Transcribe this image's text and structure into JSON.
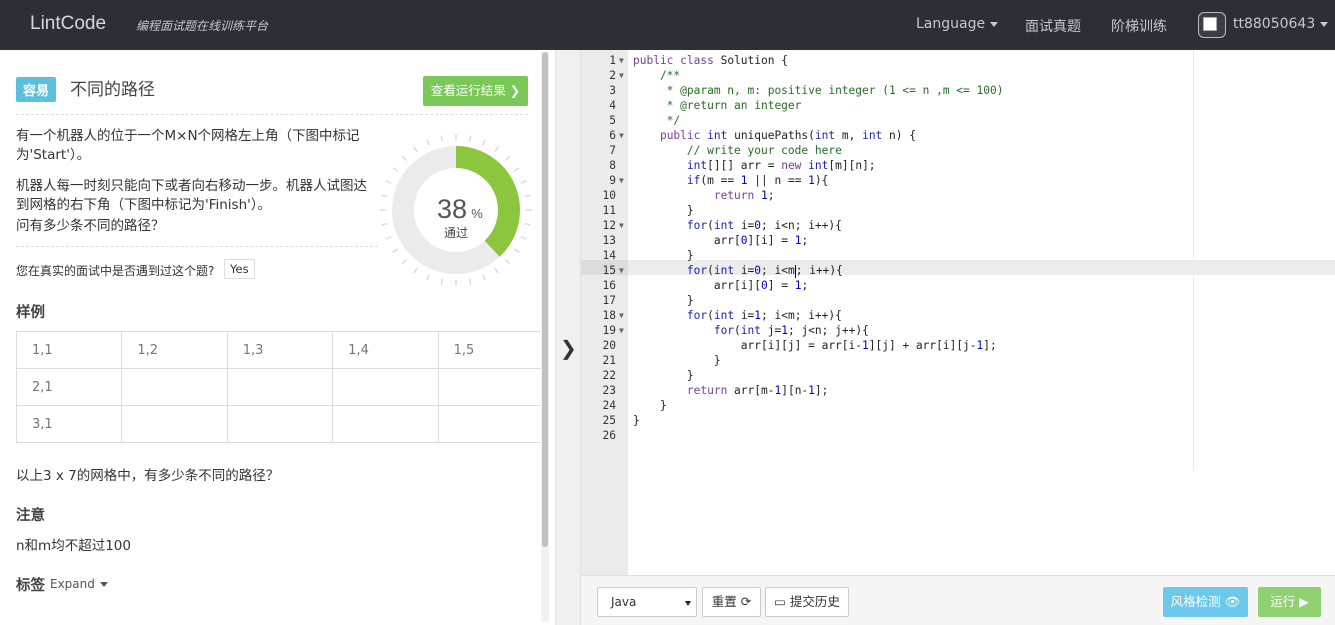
{
  "header": {
    "logo": "LintCode",
    "tagline": "编程面试题在线训练平台",
    "nav": [
      "Language",
      "面试真题",
      "阶梯训练"
    ],
    "username": "tt88050643"
  },
  "problem": {
    "difficulty": "容易",
    "title": "不同的路径",
    "view_results_label": "查看运行结果 ❯",
    "desc_p1": "有一个机器人的位于一个M×N个网格左上角（下图中标记为'Start'）。",
    "desc_p2": "机器人每一时刻只能向下或者向右移动一步。机器人试图达到网格的右下角（下图中标记为'Finish'）。",
    "desc_p3": "问有多少条不同的路径？",
    "pass_rate": 38,
    "pass_percent_sign": "%",
    "pass_label": "通过",
    "interview_question": "您在真实的面试中是否遇到过这个题?",
    "yes_label": "Yes",
    "example_heading": "样例",
    "grid": [
      [
        "1,1",
        "1,2",
        "1,3",
        "1,4",
        "1,5"
      ],
      [
        "2,1",
        "",
        "",
        "",
        ""
      ],
      [
        "3,1",
        "",
        "",
        "",
        ""
      ]
    ],
    "grid_question": "以上3 x 7的网格中，有多少条不同的路径？",
    "note_heading": "注意",
    "note_text": "n和m均不超过100",
    "tags_heading": "标签",
    "expand_label": "Expand"
  },
  "editor": {
    "active_line": 15,
    "lines": [
      "public class Solution {",
      "    /**",
      "     * @param n, m: positive integer (1 <= n ,m <= 100)",
      "     * @return an integer",
      "     */",
      "    public int uniquePaths(int m, int n) {",
      "        // write your code here",
      "        int[][] arr = new int[m][n];",
      "        if(m == 1 || n == 1){",
      "            return 1;",
      "        }",
      "        for(int i=0; i<n; i++){",
      "            arr[0][i] = 1;",
      "        }",
      "        for(int i=0; i<m; i++){",
      "            arr[i][0] = 1;",
      "        }",
      "        for(int i=1; i<m; i++){",
      "            for(int j=1; j<n; j++){",
      "                arr[i][j] = arr[i-1][j] + arr[i][j-1];",
      "            }",
      "        }",
      "        return arr[m-1][n-1];",
      "    }",
      "}",
      ""
    ],
    "fold_lines": [
      1,
      2,
      6,
      9,
      12,
      15,
      18,
      19
    ]
  },
  "toolbar": {
    "language": "Java",
    "reset_label": "重置 ⟳",
    "history_label": "提交历史",
    "style_check_label": "风格检测 👁",
    "run_label": "运行 ▶"
  },
  "colors": {
    "nav_bg": "#2c3036",
    "accent_green": "#79c858",
    "accent_blue": "#5bc0de",
    "donut_green": "#8cc63f",
    "donut_grey": "#ebebeb"
  }
}
